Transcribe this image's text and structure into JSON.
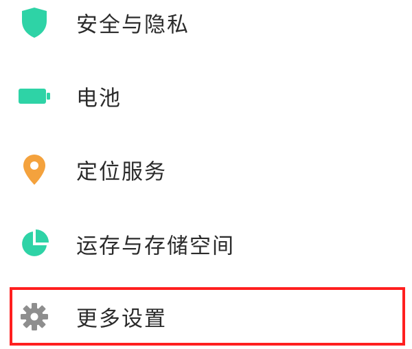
{
  "settings": {
    "items": [
      {
        "label": "安全与隐私",
        "icon": "shield-icon"
      },
      {
        "label": "电池",
        "icon": "battery-icon"
      },
      {
        "label": "定位服务",
        "icon": "location-pin-icon"
      },
      {
        "label": "运存与存储空间",
        "icon": "pie-chart-icon"
      },
      {
        "label": "更多设置",
        "icon": "gear-icon"
      }
    ]
  },
  "colors": {
    "accent_teal": "#2ed3a6",
    "location_orange": "#f4a23d",
    "gear_gray": "#8e8e8e",
    "highlight_red": "#ff1f1f",
    "text": "#2b2b2b"
  }
}
